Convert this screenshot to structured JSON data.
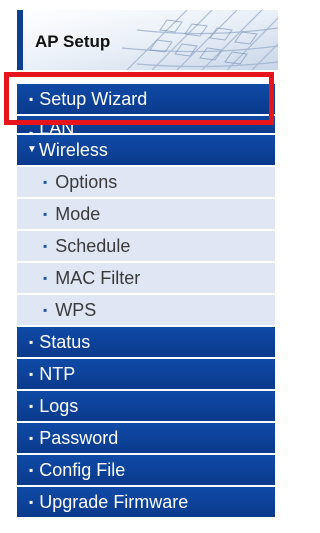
{
  "header": {
    "title": "AP Setup"
  },
  "menu": {
    "items": [
      {
        "label": "Setup Wizard",
        "level": "top",
        "bullet": "▪"
      },
      {
        "label": "LAN",
        "level": "top",
        "bullet": "▪"
      },
      {
        "label": "Wireless",
        "level": "top",
        "bullet": "▼",
        "expanded": true
      },
      {
        "label": "Options",
        "level": "sub",
        "bullet": "▪"
      },
      {
        "label": "Mode",
        "level": "sub",
        "bullet": "▪"
      },
      {
        "label": "Schedule",
        "level": "sub",
        "bullet": "▪"
      },
      {
        "label": "MAC Filter",
        "level": "sub",
        "bullet": "▪"
      },
      {
        "label": "WPS",
        "level": "sub",
        "bullet": "▪"
      },
      {
        "label": "Status",
        "level": "top",
        "bullet": "▪"
      },
      {
        "label": "NTP",
        "level": "top",
        "bullet": "▪"
      },
      {
        "label": "Logs",
        "level": "top",
        "bullet": "▪"
      },
      {
        "label": "Password",
        "level": "top",
        "bullet": "▪"
      },
      {
        "label": "Config File",
        "level": "top",
        "bullet": "▪"
      },
      {
        "label": "Upgrade Firmware",
        "level": "top",
        "bullet": "▪"
      }
    ]
  },
  "colors": {
    "menu_top_bg": "#0c3f96",
    "menu_sub_bg": "#dfe6f4",
    "highlight": "#e8141c",
    "header_accent": "#0d3f8f"
  },
  "icons": {
    "bullet": "square-bullet-icon",
    "expand": "triangle-down-icon"
  }
}
